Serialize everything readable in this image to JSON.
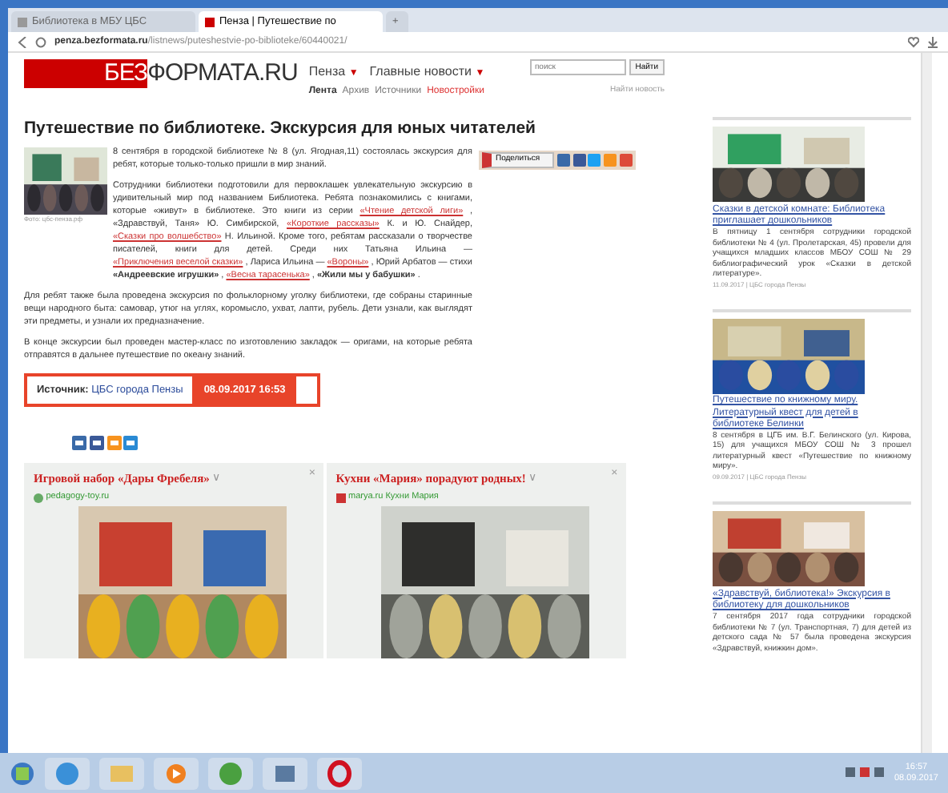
{
  "browser": {
    "tabs": [
      {
        "title": "Библиотека в МБУ ЦБС",
        "selected": false
      },
      {
        "title": "Пенза | Путешествие по",
        "selected": true
      }
    ],
    "new_tab": "+",
    "address_host": "penza.bezformata.ru",
    "address_path": "/listnews/puteshestvie-po-biblioteke/60440021/"
  },
  "site": {
    "logo_accent": "БЕЗ",
    "logo_rest": "ФОРМАТА.RU",
    "menus": [
      {
        "label": "Пенза",
        "caret": "▼"
      },
      {
        "label": "Главные новости",
        "caret": "▼"
      }
    ],
    "subnav": [
      {
        "label": "Лента",
        "selected": true,
        "kind": "plain"
      },
      {
        "label": "Архив",
        "selected": false,
        "kind": "plain"
      },
      {
        "label": "Источники",
        "selected": false,
        "kind": "plain"
      },
      {
        "label": "Новостройки",
        "selected": false,
        "kind": "promo"
      }
    ],
    "search": {
      "placeholder": "поиск",
      "button": "Найти",
      "link": "Найти новость"
    }
  },
  "article": {
    "title": "Путешествие по библиотеке. Экскурсия для юных читателей",
    "photo_caption": "Фото: цбс-пенза.рф",
    "share_button": "Поделиться",
    "paragraphs": [
      [
        {
          "kind": "plain",
          "text": "8 сентября в городской библиотеке № 8 (ул. Ягодная,11) состоялась экскурсия для ребят, которые только-только пришли в мир знаний."
        }
      ],
      [
        {
          "kind": "plain",
          "text": "Сотрудники библиотеки подготовили для первоклашек увлекательную экскурсию в удивительный мир под названием Библиотека. Ребята познакомились с книгами, которые «живут» в библиотеке. Это книги из серии"
        },
        {
          "kind": "link",
          "text": "«Чтение детской лиги»"
        },
        {
          "kind": "plain",
          "text": ", «Здравствуй, Таня» Ю. Симбирской,"
        },
        {
          "kind": "link",
          "text": "«Короткие рассказы»"
        },
        {
          "kind": "plain",
          "text": "К. и Ю. Снайдер,"
        },
        {
          "kind": "link",
          "text": "«Сказки про волшебство»"
        },
        {
          "kind": "plain",
          "text": "Н. Ильиной. Кроме того, ребятам рассказали о творчестве писателей, книги для детей. Среди них Татьяна Ильина —"
        },
        {
          "kind": "link",
          "text": "«Приключения веселой сказки»"
        },
        {
          "kind": "plain",
          "text": ", Лариса Ильина —"
        },
        {
          "kind": "link",
          "text": "«Вороны»"
        },
        {
          "kind": "plain",
          "text": ", Юрий Арбатов — стихи"
        },
        {
          "kind": "bold",
          "text": "«Андреевские игрушки»"
        },
        {
          "kind": "plain",
          "text": ","
        },
        {
          "kind": "link",
          "text": "«Весна тарасенька»"
        },
        {
          "kind": "plain",
          "text": ","
        },
        {
          "kind": "bold",
          "text": "«Жили мы у бабушки»"
        },
        {
          "kind": "plain",
          "text": "."
        }
      ],
      [
        {
          "kind": "plain",
          "text": "Для ребят также была проведена экскурсия по фольклорному уголку библиотеки, где собраны старинные вещи народного быта: самовар, утюг на углях, коромысло, ухват, лапти, рубель. Дети узнали, как выглядят эти предметы, и узнали их предназначение."
        }
      ],
      [
        {
          "kind": "plain",
          "text": "В конце экскурсии был проведен мастер-класс по изготовлению закладок — оригами, на которые ребята отправятся в дальнее путешествие по океану знаний."
        }
      ]
    ],
    "source_label": "Источник:",
    "source_link": "ЦБС города Пензы",
    "date": "08.09.2017  16:53"
  },
  "ads": [
    {
      "title": "Игровой набор «Дары Фребеля»",
      "caret": "∨",
      "close": "×",
      "domain": "pedagogy-toy.ru"
    },
    {
      "title": "Кухни «Мария» порадуют родных!",
      "caret": "∨",
      "close": "×",
      "domain": "marya.ru Кухни Мария"
    }
  ],
  "sidebar": [
    {
      "title": "Сказки в детской комнате: Библиотека приглашает дошкольников",
      "snippet": "В пятницу 1 сентября сотрудники городской библиотеки № 4 (ул. Пролетарская, 45) провели для учащихся младших классов МБОУ СОШ № 29 библиографический урок «Сказки в детской литературе».",
      "meta": "11.09.2017 | ЦБС города Пензы"
    },
    {
      "title": "Путешествие по книжному миру. Литературный квест для детей в библиотеке Белинки",
      "snippet": "8 сентября в ЦГБ им. В.Г. Белинского (ул. Кирова, 15) для учащихся МБОУ СОШ № 3 прошел литературный квест «Путешествие по книжному миру».",
      "meta": "09.09.2017 | ЦБС города Пензы"
    },
    {
      "title": "«Здравствуй, библиотека!» Экскурсия в библиотеку для дошкольников",
      "snippet": "7 сентября 2017 года сотрудники городской библиотеки № 7 (ул. Транспортная, 7) для детей из детского сада № 57 была проведена экскурсия «Здравствуй, книжкин дом»."
    }
  ],
  "taskbar": {
    "time": "16:57",
    "date": "08.09.2017"
  }
}
